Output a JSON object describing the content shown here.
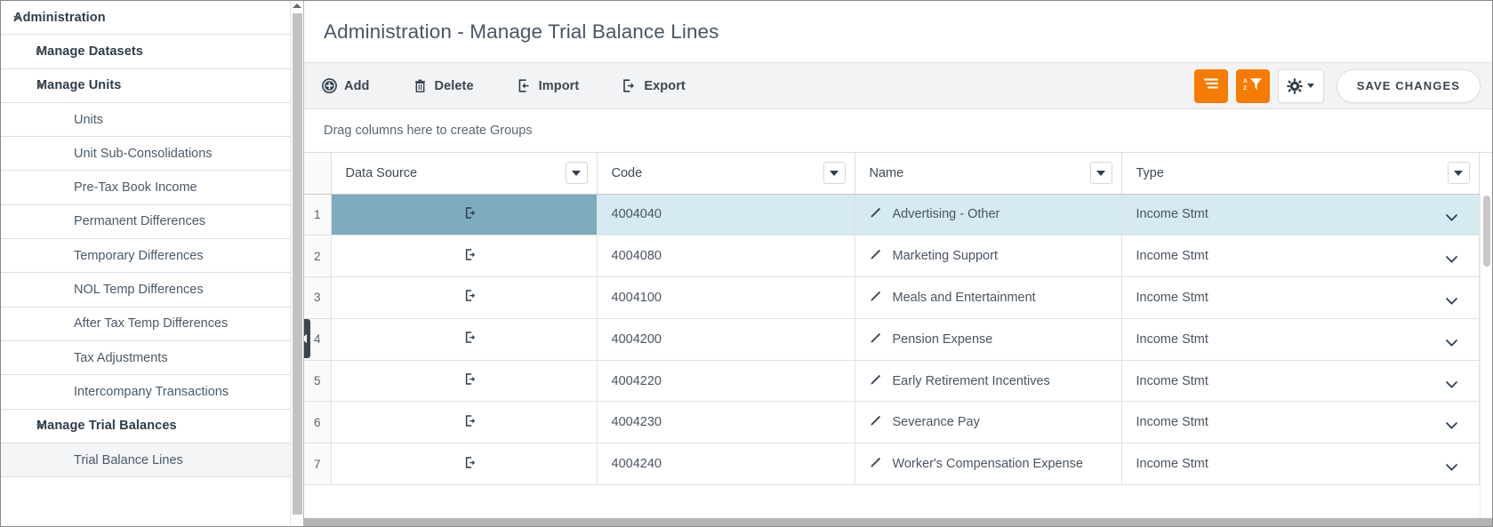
{
  "sidebar": {
    "items": [
      {
        "label": "Administration",
        "level": 0,
        "caret": "down",
        "selected": false
      },
      {
        "label": "Manage Datasets",
        "level": 1,
        "caret": "right",
        "selected": false
      },
      {
        "label": "Manage Units",
        "level": 1,
        "caret": "down",
        "selected": false
      },
      {
        "label": "Units",
        "level": 2,
        "caret": "none",
        "selected": false
      },
      {
        "label": "Unit Sub-Consolidations",
        "level": 2,
        "caret": "none",
        "selected": false
      },
      {
        "label": "Pre-Tax Book Income",
        "level": 2,
        "caret": "none",
        "selected": false
      },
      {
        "label": "Permanent Differences",
        "level": 2,
        "caret": "none",
        "selected": false
      },
      {
        "label": "Temporary Differences",
        "level": 2,
        "caret": "none",
        "selected": false
      },
      {
        "label": "NOL Temp Differences",
        "level": 2,
        "caret": "none",
        "selected": false
      },
      {
        "label": "After Tax Temp Differences",
        "level": 2,
        "caret": "none",
        "selected": false
      },
      {
        "label": "Tax Adjustments",
        "level": 2,
        "caret": "none",
        "selected": false
      },
      {
        "label": "Intercompany Transactions",
        "level": 2,
        "caret": "none",
        "selected": false
      },
      {
        "label": "Manage Trial Balances",
        "level": 1,
        "caret": "down",
        "selected": false
      },
      {
        "label": "Trial Balance Lines",
        "level": 2,
        "caret": "none",
        "selected": true
      }
    ]
  },
  "header": {
    "title": "Administration - Manage Trial Balance Lines"
  },
  "toolbar": {
    "buttons": [
      {
        "label": "Add",
        "icon": "plus-circle-icon"
      },
      {
        "label": "Delete",
        "icon": "trash-icon"
      },
      {
        "label": "Import",
        "icon": "import-arrow-icon"
      },
      {
        "label": "Export",
        "icon": "export-arrow-icon"
      }
    ],
    "group_button_icon": "group-lines-icon",
    "sort_button_icon": "sort-az-filter-icon",
    "settings_button_icon": "gear-icon",
    "save_label": "SAVE CHANGES",
    "accent_color": "#f57c00"
  },
  "group_zone": {
    "placeholder": "Drag columns here to create Groups"
  },
  "grid": {
    "columns": [
      {
        "key": "index",
        "label": ""
      },
      {
        "key": "data_source",
        "label": "Data Source",
        "menu": true
      },
      {
        "key": "code",
        "label": "Code",
        "menu": true
      },
      {
        "key": "name",
        "label": "Name",
        "menu": true
      },
      {
        "key": "type",
        "label": "Type",
        "menu": true
      }
    ],
    "rows": [
      {
        "index": "1",
        "data_source": "export-arrow-icon",
        "code": "4004040",
        "name": "Advertising - Other",
        "type": "Income Stmt",
        "selected": true
      },
      {
        "index": "2",
        "data_source": "export-arrow-icon",
        "code": "4004080",
        "name": "Marketing Support",
        "type": "Income Stmt",
        "selected": false
      },
      {
        "index": "3",
        "data_source": "export-arrow-icon",
        "code": "4004100",
        "name": "Meals and Entertainment",
        "type": "Income Stmt",
        "selected": false
      },
      {
        "index": "4",
        "data_source": "export-arrow-icon",
        "code": "4004200",
        "name": "Pension Expense",
        "type": "Income Stmt",
        "selected": false
      },
      {
        "index": "5",
        "data_source": "export-arrow-icon",
        "code": "4004220",
        "name": "Early Retirement Incentives",
        "type": "Income Stmt",
        "selected": false
      },
      {
        "index": "6",
        "data_source": "export-arrow-icon",
        "code": "4004230",
        "name": "Severance Pay",
        "type": "Income Stmt",
        "selected": false
      },
      {
        "index": "7",
        "data_source": "export-arrow-icon",
        "code": "4004240",
        "name": "Worker's Compensation Expense",
        "type": "Income Stmt",
        "selected": false
      }
    ],
    "selected_cell_color": "#7fabbf",
    "selected_row_color": "#d5eaf2"
  }
}
